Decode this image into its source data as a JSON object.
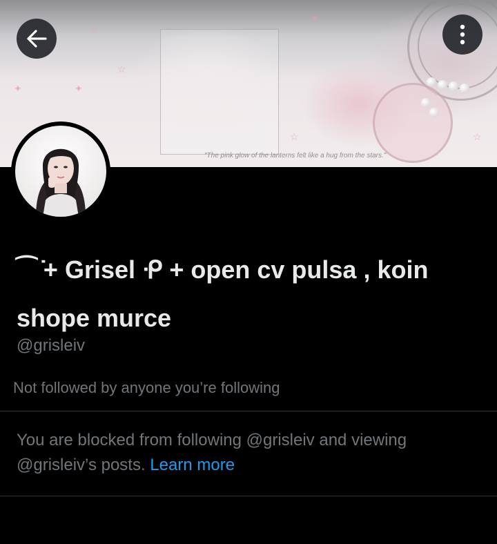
{
  "header": {
    "banner_quote": "\"The pink glow of the lanterns felt like a hug from the stars.\"",
    "back_icon": "arrow-left-icon",
    "more_icon": "more-vertical-icon"
  },
  "profile": {
    "display_name": "⁀ ̇+ Grisel ᑶ + open cv pulsa , koin shope murce",
    "handle": "@grisleiv",
    "followers_you_know": "Not followed by anyone you’re following"
  },
  "blocked_notice": {
    "text": "You are blocked from following @grisleiv and viewing @grisleiv’s posts.",
    "link": "Learn more"
  },
  "colors": {
    "background": "#000000",
    "primary_text": "#e7e9ea",
    "secondary_text": "#71767b",
    "link": "#1d9bf0",
    "divider": "#2f3336"
  }
}
